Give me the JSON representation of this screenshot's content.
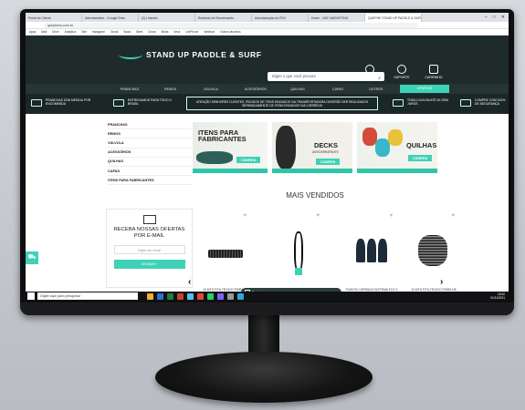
{
  "browser": {
    "tabs": [
      "Portal do Cliente",
      "Administrativo - Google Drive",
      "(2) Linkedin",
      "Relatório de Recebimento",
      "Administração do PDV",
      "Home - UBC MARKETING",
      "QUEPHE STAND UP PADDLE & SURF"
    ],
    "address": "quepheno.com.br",
    "bookmarks": [
      "Apps",
      "Mail",
      "Drive",
      "Analytics",
      "Site",
      "Instagram",
      "Gmail",
      "Slack",
      "Meet",
      "Clean",
      "Mídia",
      "Veck",
      "UniPhone",
      "Webinar",
      "Outros favoritos"
    ]
  },
  "site": {
    "logo_text": "STAND UP PADDLE & SURF",
    "search_placeholder": "Digite o que você procura",
    "actions": [
      {
        "label": "ENTRAR"
      },
      {
        "label": "SUPORTE"
      },
      {
        "label": "CARRINHO"
      }
    ],
    "nav": [
      "PRANCHAS",
      "REMOS",
      "VÁLVULA",
      "ACESSÓRIOS",
      "QUILHAS",
      "CAPAS",
      "OUTROS"
    ],
    "nav_promo": "OFERTAS",
    "info": [
      {
        "text": "PRANCHAS SOB MEDIDA POR ENCOMENDA"
      },
      {
        "text": "ENTREGAMOS PARA TODO O BRASIL"
      },
      {
        "text": "TODA LOJA EM ATÉ 6X SEM JUROS"
      },
      {
        "text": "COMPRE COM 100% DE SEGURANÇA"
      }
    ],
    "notice": "ATENÇÃO SENHORES CLIENTES, PEDIDOS DE ITENS ENVIADOS VIA TRANSPORTADORA DEVERÃO SER REALIZADOS SEPARADAMENTE DE ITENS ENVIADOS VIA CORREIOS",
    "categories": [
      "PRANCHAS",
      "REMOS",
      "VÁLVULA",
      "ACESSÓRIOS",
      "QUILHAS",
      "CAPAS",
      "ITENS PARA FABRICANTES"
    ],
    "newsletter": {
      "title": "RECEBA NOSSAS OFERTAS POR E-MAIL",
      "placeholder": "Digite seu email",
      "button": "ASSINAR"
    },
    "banners": [
      {
        "title": "ITENS PARA FABRICANTES",
        "button": "CONFIRA"
      },
      {
        "title": "DECKS",
        "subtitle": "ANTIDERRAPANTE",
        "button": "CONFIRA"
      },
      {
        "title": "QUILHAS",
        "button": "CONFIRA"
      }
    ],
    "best_sellers_title": "MAIS VENDIDOS",
    "products": [
      {
        "name": "10 MTS FITA TECIDO FIBRA DE CARBONO"
      },
      {
        "name": "LEASH"
      },
      {
        "name": "FUSION CORPADO SISTEMA FCS 2 SURF"
      },
      {
        "name": "10 MTS FITA TECIDO FIBRA DE CARBONO"
      }
    ],
    "chat_label": "Envie-nos uma mensagem"
  },
  "taskbar": {
    "search_placeholder": "Digite aqui para pesquisar",
    "time": "15:52",
    "date": "01/11/2021"
  },
  "colors": {
    "accent": "#3fd1b5",
    "header": "#1f2b2b"
  }
}
